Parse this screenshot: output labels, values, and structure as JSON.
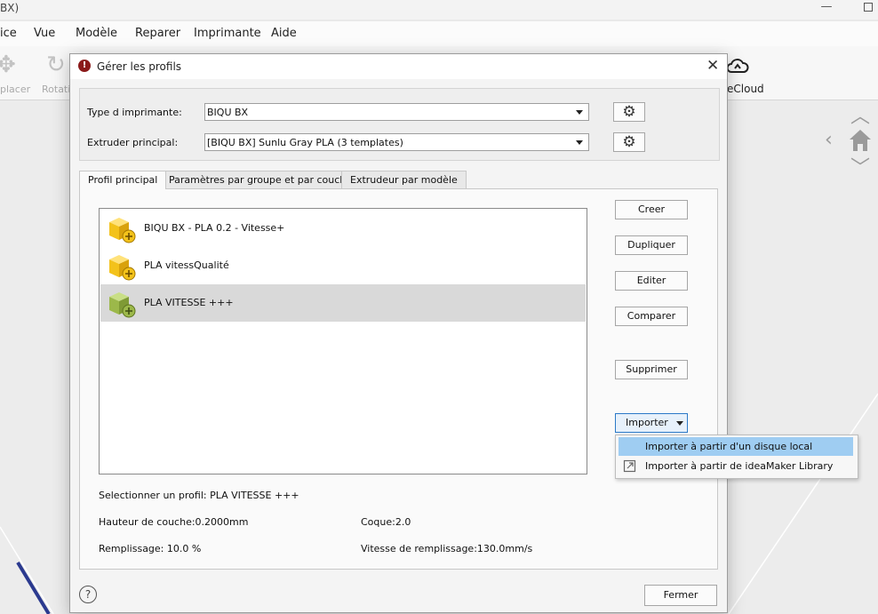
{
  "app": {
    "title": "BX)",
    "menu": [
      "ice",
      "Vue",
      "Modèle",
      "Reparer",
      "Imprimante",
      "Aide"
    ],
    "toolbar": {
      "left_label_1": "placer",
      "left_label_2": "Rotatio",
      "cloud_label": "eCloud"
    }
  },
  "dialog": {
    "title": "Gérer les profils",
    "printer_type_label": "Type d imprimante:",
    "printer_type_value": "BIQU BX",
    "extruder_label": "Extruder principal:",
    "extruder_value": "[BIQU BX] Sunlu Gray PLA (3 templates)",
    "tabs": [
      "Profil principal",
      "Paramètres par groupe et par couche",
      "Extrudeur par modèle"
    ],
    "profiles": [
      {
        "name": "BIQU BX - PLA 0.2 - Vitesse+",
        "selected": false
      },
      {
        "name": "PLA vitessQualité",
        "selected": false
      },
      {
        "name": "PLA VITESSE +++",
        "selected": true
      }
    ],
    "buttons": {
      "create": "Creer",
      "duplicate": "Dupliquer",
      "edit": "Editer",
      "compare": "Comparer",
      "delete": "Supprimer",
      "import": "Importer",
      "close": "Fermer",
      "help": "?"
    },
    "info": {
      "selected_profile": "Selectionner un profil: PLA VITESSE +++",
      "layer_height": "Hauteur de couche:0.2000mm",
      "shell": "Coque:2.0",
      "infill": "Remplissage: 10.0 %",
      "infill_speed": "Vitesse de remplissage:130.0mm/s"
    },
    "import_menu": [
      {
        "label": "Importer à partir d'un disque local",
        "highlighted": true
      },
      {
        "label": "Importer à partir de ideaMaker Library",
        "highlighted": false
      }
    ]
  },
  "colors": {
    "highlight": "#9fcdf2",
    "selected_row": "#d9d9d9",
    "cube_yellow": "#f3c21b",
    "cube_green": "#9cb84a",
    "title_icon": "#8b1a1a"
  }
}
